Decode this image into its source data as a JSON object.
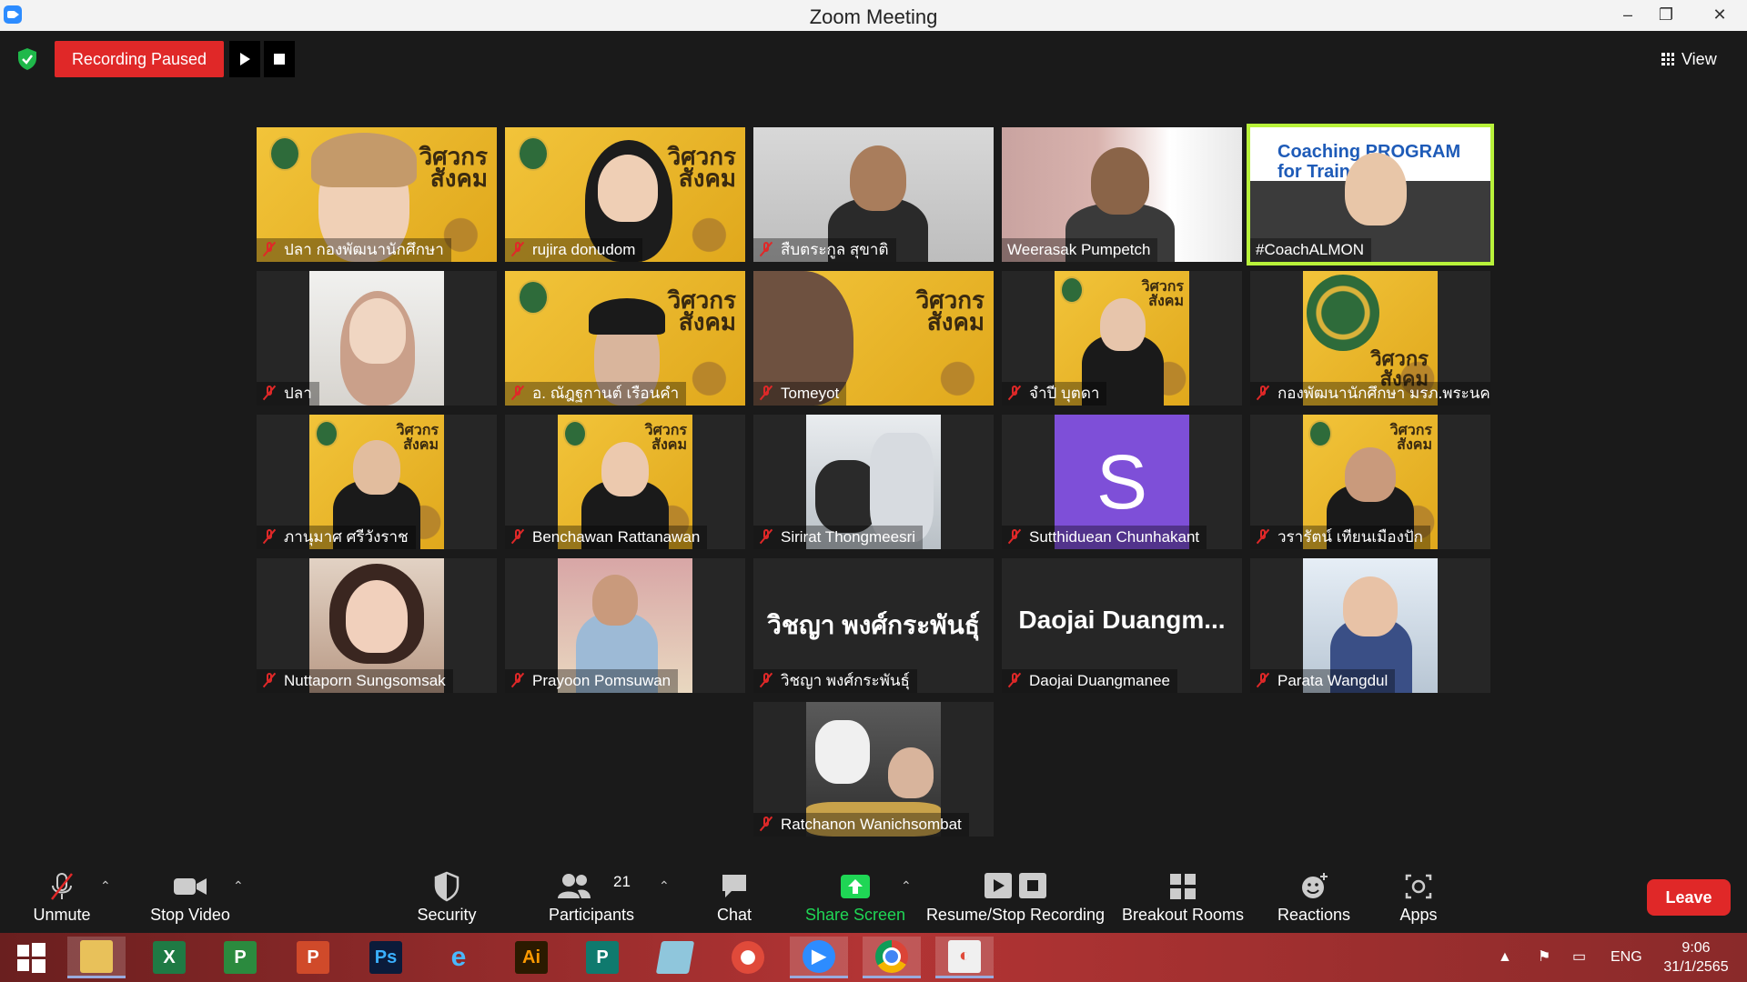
{
  "window": {
    "title": "Zoom Meeting",
    "minimize": "–",
    "maximize": "❐",
    "close": "✕"
  },
  "recording": {
    "status": "Recording Paused"
  },
  "view": {
    "label": "View"
  },
  "tiles": [
    {
      "name": "ปลา กองพัฒนานักศึกษา"
    },
    {
      "name": "rujira donudom"
    },
    {
      "name": "สืบตระกูล สุขาติ"
    },
    {
      "name": "Weerasak Pumpetch"
    },
    {
      "name": "#CoachALMON",
      "slide_text": "Coaching PROGRAM for Trainer"
    },
    {
      "name": "ปลา"
    },
    {
      "name": "อ. ณัฎฐกานต์ เรือนคำ"
    },
    {
      "name": "Tomeyot"
    },
    {
      "name": "จำปี บุตดา"
    },
    {
      "name": "กองพัฒนานักศึกษา มรภ.พระนคร"
    },
    {
      "name": "ภานุมาศ ศรีวังราช"
    },
    {
      "name": "Benchawan Rattanawan"
    },
    {
      "name": "Sirirat Thongmeesri"
    },
    {
      "name": "Sutthiduean Chunhakant",
      "avatar_letter": "S"
    },
    {
      "name": "วรารัตน์ เทียนเมืองปัก"
    },
    {
      "name": "Nuttaporn Sungsomsak"
    },
    {
      "name": "Prayoon Pomsuwan"
    },
    {
      "name": "วิชญา พงศ์กระพันธุ์",
      "display": "วิชญา พงศ์กระพันธุ์"
    },
    {
      "name": "Daojai Duangmanee",
      "display": "Daojai  Duangm..."
    },
    {
      "name": "Parata Wangdul"
    },
    {
      "name": "Ratchanon Wanichsombat"
    }
  ],
  "wordmark": "วิศวกร\nสังคม",
  "toolbar": {
    "unmute": "Unmute",
    "stop_video": "Stop Video",
    "security": "Security",
    "participants": "Participants",
    "participants_count": "21",
    "chat": "Chat",
    "share_screen": "Share Screen",
    "resume_stop": "Resume/Stop Recording",
    "breakout": "Breakout Rooms",
    "reactions": "Reactions",
    "apps": "Apps",
    "leave": "Leave"
  },
  "taskbar": {
    "language": "ENG",
    "time": "9:06",
    "date": "31/1/2565",
    "apps": [
      "windows-start",
      "file-explorer",
      "excel",
      "project",
      "powerpoint",
      "photoshop",
      "internet-explorer",
      "illustrator",
      "publisher",
      "notes",
      "photoscape",
      "zoom",
      "chrome",
      "photo-viewer"
    ]
  },
  "colors": {
    "accent_red": "#e02828",
    "share_green": "#1fd655",
    "active_speaker": "#b8f23a",
    "avatar_purple": "#7e4fd8"
  }
}
